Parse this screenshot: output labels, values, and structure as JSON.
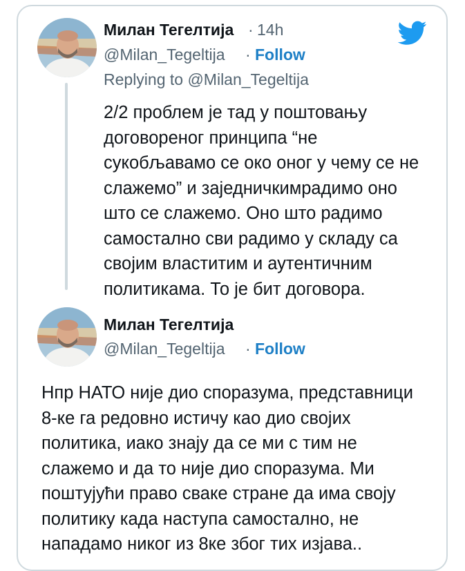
{
  "brand": {
    "accent": "#1d9bf0",
    "follow_color": "#1d7fc6"
  },
  "tweet1": {
    "author_name": "Милан Тегелтија",
    "separator": "·",
    "time": "14h",
    "handle": "@Milan_Tegeltija",
    "follow_separator": "·",
    "follow_label": "Follow",
    "replying_to": "Replying to @Milan_Tegeltija",
    "text": "2/2 проблем је тад у поштовању\nдоговореног принципа “не\nсукобљавамо се око оног у чему се не\nслажемо” и заједничкимрадимо оно\nшто се слажемо. Оно што радимо\nсамостално сви радимо у складу са\nсвојим властитим и аутентичним\nполитикама. То је бит договора."
  },
  "tweet2": {
    "author_name": "Милан Тегелтија",
    "handle": "@Milan_Tegeltija",
    "follow_separator": "·",
    "follow_label": "Follow",
    "text": "Нпр НАТО није дио споразума, представници\n8-ке га редовно истичу као дио својих\nполитика, иако знају да се ми с тим не\nслажемо и да то није дио споразума. Ми\nпоштујући право сваке стране да има своју\nполитику када наступа самостално, не\nнападамо никог из 8ке због тих изјава.."
  },
  "icons": {
    "brand": "twitter-bird-icon"
  }
}
